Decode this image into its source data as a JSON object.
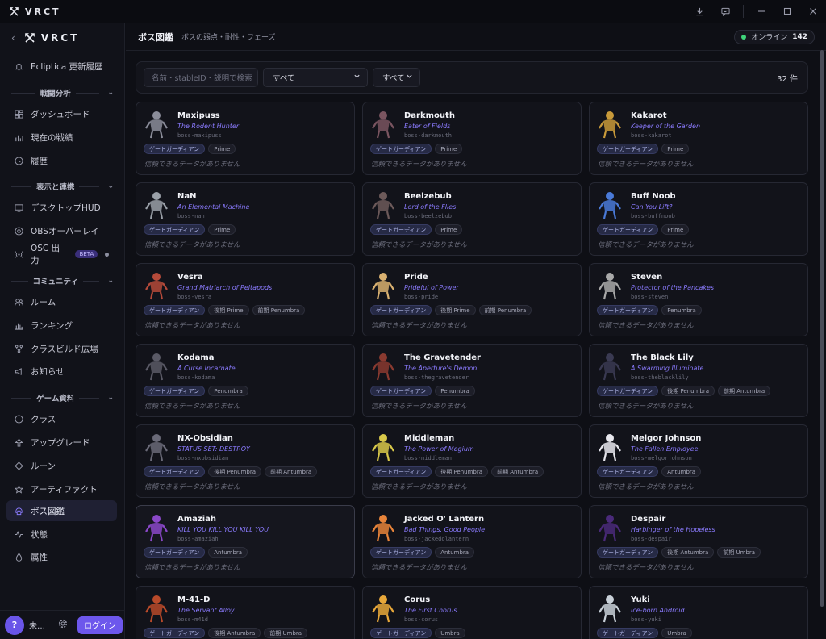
{
  "titlebar": {
    "app_name": "VRCT"
  },
  "sidebar": {
    "brand": "VRCT",
    "top_item": "Ecliptica 更新履歴",
    "sections": [
      {
        "label": "戦闘分析",
        "items": [
          "ダッシュボード",
          "現在の戦績",
          "履歴"
        ]
      },
      {
        "label": "表示と連携",
        "items": [
          "デスクトップHUD",
          "OBSオーバーレイ",
          "OSC 出力"
        ]
      },
      {
        "label": "コミュニティ",
        "items": [
          "ルーム",
          "ランキング",
          "クラスビルド広場",
          "お知らせ"
        ]
      },
      {
        "label": "ゲーム資料",
        "items": [
          "クラス",
          "アップグレード",
          "ルーン",
          "アーティファクト",
          "ボス図鑑",
          "状態",
          "属性"
        ]
      }
    ],
    "beta_badge": "BETA",
    "footer": {
      "avatar": "?",
      "user": "未…",
      "login": "ログイン"
    }
  },
  "header": {
    "title": "ボス図鑑",
    "subtitle": "ボスの弱点・耐性・フェーズ",
    "online_label": "オンライン",
    "online_count": "142"
  },
  "filters": {
    "search_placeholder": "名前・stableID・説明で検索",
    "select1": "すべて",
    "select2": "すべて",
    "count": "32 件"
  },
  "card_nodata": "信頼できるデータがありません",
  "bosses": [
    {
      "name": "Maxipuss",
      "epithet": "The Rodent Hunter",
      "id": "boss-maxipuss",
      "tags": [
        "ゲートガーディアン",
        "Prime"
      ]
    },
    {
      "name": "Darkmouth",
      "epithet": "Eater of Fields",
      "id": "boss-darkmouth",
      "tags": [
        "ゲートガーディアン",
        "Prime"
      ]
    },
    {
      "name": "Kakarot",
      "epithet": "Keeper of the Garden",
      "id": "boss-kakarot",
      "tags": [
        "ゲートガーディアン",
        "Prime"
      ]
    },
    {
      "name": "NaN",
      "epithet": "An Elemental Machine",
      "id": "boss-nan",
      "tags": [
        "ゲートガーディアン",
        "Prime"
      ]
    },
    {
      "name": "Beelzebub",
      "epithet": "Lord of the Flies",
      "id": "boss-beelzebub",
      "tags": [
        "ゲートガーディアン",
        "Prime"
      ]
    },
    {
      "name": "Buff Noob",
      "epithet": "Can You Lift?",
      "id": "boss-buffnoob",
      "tags": [
        "ゲートガーディアン",
        "Prime"
      ]
    },
    {
      "name": "Vesra",
      "epithet": "Grand Matriarch of Peltapods",
      "id": "boss-vesra",
      "tags": [
        "ゲートガーディアン",
        "後期 Prime",
        "前期 Penumbra"
      ]
    },
    {
      "name": "Pride",
      "epithet": "Prideful of Power",
      "id": "boss-pride",
      "tags": [
        "ゲートガーディアン",
        "後期 Prime",
        "前期 Penumbra"
      ]
    },
    {
      "name": "Steven",
      "epithet": "Protector of the Pancakes",
      "id": "boss-steven",
      "tags": [
        "ゲートガーディアン",
        "Penumbra"
      ]
    },
    {
      "name": "Kodama",
      "epithet": "A Curse Incarnate",
      "id": "boss-kodama",
      "tags": [
        "ゲートガーディアン",
        "Penumbra"
      ]
    },
    {
      "name": "The Gravetender",
      "epithet": "The Aperture's Demon",
      "id": "boss-thegravetender",
      "tags": [
        "ゲートガーディアン",
        "Penumbra"
      ]
    },
    {
      "name": "The Black Lily",
      "epithet": "A Swarming Illuminate",
      "id": "boss-theblacklily",
      "tags": [
        "ゲートガーディアン",
        "後期 Penumbra",
        "前期 Antumbra"
      ]
    },
    {
      "name": "NX-Obsidian",
      "epithet": "STATUS SET: DESTROY",
      "id": "boss-nxobsidian",
      "tags": [
        "ゲートガーディアン",
        "後期 Penumbra",
        "前期 Antumbra"
      ]
    },
    {
      "name": "Middleman",
      "epithet": "The Power of Megium",
      "id": "boss-middleman",
      "tags": [
        "ゲートガーディアン",
        "後期 Penumbra",
        "前期 Antumbra"
      ]
    },
    {
      "name": "Melgor Johnson",
      "epithet": "The Fallen Employee",
      "id": "boss-melgorjohnson",
      "tags": [
        "ゲートガーディアン",
        "Antumbra"
      ]
    },
    {
      "name": "Amaziah",
      "epithet": "KILL YOU KILL YOU KILL YOU",
      "id": "boss-amaziah",
      "tags": [
        "ゲートガーディアン",
        "Antumbra"
      ]
    },
    {
      "name": "Jacked O' Lantern",
      "epithet": "Bad Things, Good People",
      "id": "boss-jackedolantern",
      "tags": [
        "ゲートガーディアン",
        "Antumbra"
      ]
    },
    {
      "name": "Despair",
      "epithet": "Harbinger of the Hopeless",
      "id": "boss-despair",
      "tags": [
        "ゲートガーディアン",
        "後期 Antumbra",
        "前期 Umbra"
      ]
    },
    {
      "name": "M-41-D",
      "epithet": "The Servant Alloy",
      "id": "boss-m41d",
      "tags": [
        "ゲートガーディアン",
        "後期 Antumbra",
        "前期 Umbra"
      ]
    },
    {
      "name": "Corus",
      "epithet": "The First Chorus",
      "id": "boss-corus",
      "tags": [
        "ゲートガーディアン",
        "Umbra"
      ]
    },
    {
      "name": "Yuki",
      "epithet": "Ice-born Android",
      "id": "boss-yuki",
      "tags": [
        "ゲートガーディアン",
        "Umbra"
      ]
    }
  ]
}
